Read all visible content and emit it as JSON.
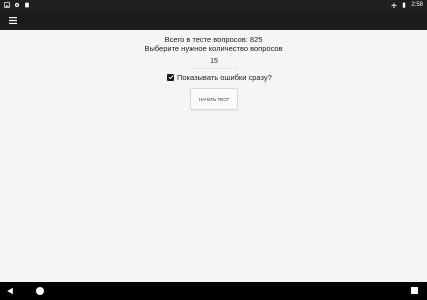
{
  "status_bar": {
    "time": "2:58",
    "left_icons": [
      "image-icon",
      "settings-icon",
      "sd-card-icon"
    ],
    "right_icons": [
      "airplane-mode-icon",
      "battery-icon"
    ]
  },
  "app_bar": {
    "menu_icon": "hamburger-menu-icon",
    "background": "#1b1b1b"
  },
  "main": {
    "total_questions_text": "Всего в тесте вопросов: 825",
    "choose_count_text": "Выберите нужное количество вопросов",
    "question_count_value": "15",
    "show_errors_label": "Показывать ошибки сразу?",
    "show_errors_checked": true,
    "start_button_label": "начать тест"
  },
  "nav_bar": {
    "icons": [
      "back-icon",
      "home-icon",
      "recents-icon"
    ]
  }
}
